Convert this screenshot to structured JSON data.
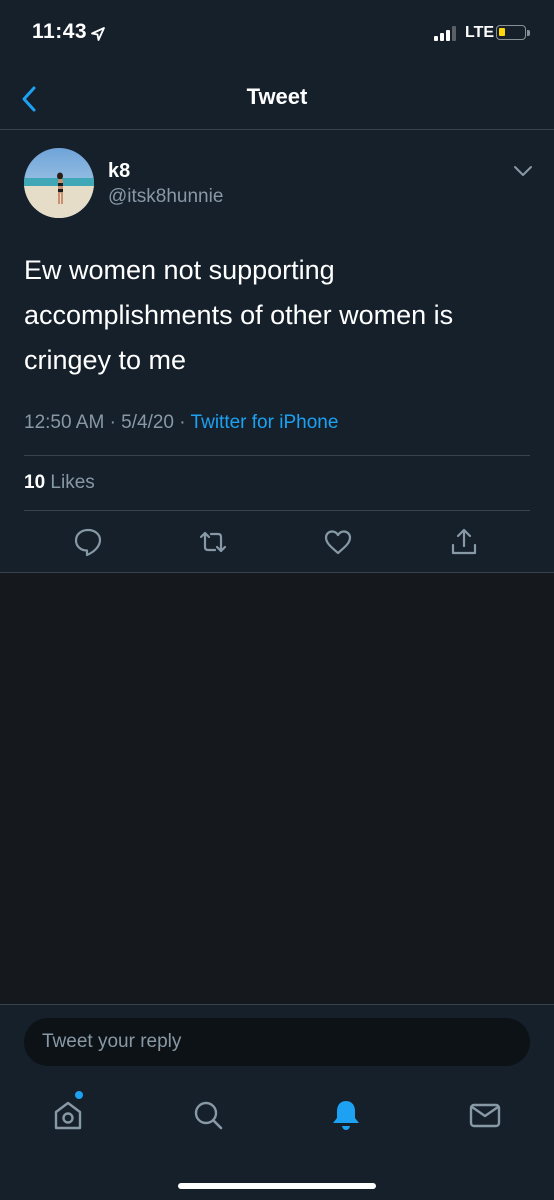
{
  "status": {
    "time": "11:43",
    "network": "LTE"
  },
  "nav": {
    "title": "Tweet"
  },
  "tweet": {
    "display_name": "k8",
    "handle": "@itsk8hunnie",
    "text": "Ew women not supporting accomplishments of other women is cringey to me",
    "time": "12:50 AM",
    "date": "5/4/20",
    "separator": "·",
    "source": "Twitter for iPhone",
    "likes_count": "10",
    "likes_label": "Likes"
  },
  "reply": {
    "placeholder": "Tweet your reply"
  },
  "colors": {
    "accent": "#1da1f2",
    "background": "#15202b",
    "secondary_text": "#8899a6"
  },
  "icons": [
    "location-arrow-icon",
    "back-chevron-icon",
    "chevron-down-icon",
    "reply-icon",
    "retweet-icon",
    "like-icon",
    "share-icon",
    "home-icon",
    "search-icon",
    "notifications-icon",
    "messages-icon"
  ]
}
